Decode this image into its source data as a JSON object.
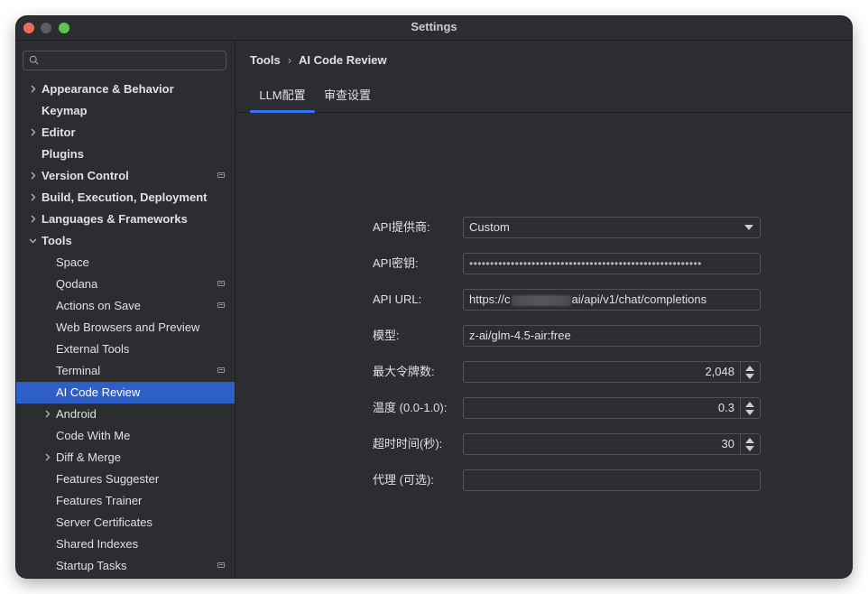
{
  "window": {
    "title": "Settings"
  },
  "search": {
    "placeholder": ""
  },
  "sidebar": {
    "items": [
      {
        "label": "Appearance & Behavior",
        "bold": true,
        "chevron": "right",
        "indent": 0,
        "badge": false,
        "selected": false
      },
      {
        "label": "Keymap",
        "bold": true,
        "chevron": "none",
        "indent": 0,
        "badge": false,
        "selected": false
      },
      {
        "label": "Editor",
        "bold": true,
        "chevron": "right",
        "indent": 0,
        "badge": false,
        "selected": false
      },
      {
        "label": "Plugins",
        "bold": true,
        "chevron": "none",
        "indent": 0,
        "badge": false,
        "selected": false
      },
      {
        "label": "Version Control",
        "bold": true,
        "chevron": "right",
        "indent": 0,
        "badge": true,
        "selected": false
      },
      {
        "label": "Build, Execution, Deployment",
        "bold": true,
        "chevron": "right",
        "indent": 0,
        "badge": false,
        "selected": false
      },
      {
        "label": "Languages & Frameworks",
        "bold": true,
        "chevron": "right",
        "indent": 0,
        "badge": false,
        "selected": false
      },
      {
        "label": "Tools",
        "bold": true,
        "chevron": "down",
        "indent": 0,
        "badge": false,
        "selected": false
      },
      {
        "label": "Space",
        "bold": false,
        "chevron": "none",
        "indent": 1,
        "badge": false,
        "selected": false
      },
      {
        "label": "Qodana",
        "bold": false,
        "chevron": "none",
        "indent": 1,
        "badge": true,
        "selected": false
      },
      {
        "label": "Actions on Save",
        "bold": false,
        "chevron": "none",
        "indent": 1,
        "badge": true,
        "selected": false
      },
      {
        "label": "Web Browsers and Preview",
        "bold": false,
        "chevron": "none",
        "indent": 1,
        "badge": false,
        "selected": false
      },
      {
        "label": "External Tools",
        "bold": false,
        "chevron": "none",
        "indent": 1,
        "badge": false,
        "selected": false
      },
      {
        "label": "Terminal",
        "bold": false,
        "chevron": "none",
        "indent": 1,
        "badge": true,
        "selected": false
      },
      {
        "label": "AI Code Review",
        "bold": false,
        "chevron": "none",
        "indent": 1,
        "badge": false,
        "selected": true
      },
      {
        "label": "Android",
        "bold": false,
        "chevron": "right",
        "indent": 1,
        "badge": false,
        "selected": false
      },
      {
        "label": "Code With Me",
        "bold": false,
        "chevron": "none",
        "indent": 1,
        "badge": false,
        "selected": false
      },
      {
        "label": "Diff & Merge",
        "bold": false,
        "chevron": "right",
        "indent": 1,
        "badge": false,
        "selected": false
      },
      {
        "label": "Features Suggester",
        "bold": false,
        "chevron": "none",
        "indent": 1,
        "badge": false,
        "selected": false
      },
      {
        "label": "Features Trainer",
        "bold": false,
        "chevron": "none",
        "indent": 1,
        "badge": false,
        "selected": false
      },
      {
        "label": "Server Certificates",
        "bold": false,
        "chevron": "none",
        "indent": 1,
        "badge": false,
        "selected": false
      },
      {
        "label": "Shared Indexes",
        "bold": false,
        "chevron": "none",
        "indent": 1,
        "badge": false,
        "selected": false
      },
      {
        "label": "Startup Tasks",
        "bold": false,
        "chevron": "none",
        "indent": 1,
        "badge": true,
        "selected": false
      }
    ]
  },
  "breadcrumb": {
    "parent": "Tools",
    "separator": "›",
    "current": "AI Code Review"
  },
  "tabs": [
    {
      "label": "LLM配置",
      "active": true
    },
    {
      "label": "审查设置",
      "active": false
    }
  ],
  "form": {
    "provider_label": "API提供商:",
    "provider_value": "Custom",
    "key_label": "API密钥:",
    "key_value": "••••••••••••••••••••••••••••••••••••••••••••••••••••••••",
    "url_label": "API URL:",
    "url_prefix": "https://c",
    "url_suffix": "ai/api/v1/chat/completions",
    "model_label": "模型:",
    "model_value": "z-ai/glm-4.5-air:free",
    "max_tokens_label": "最大令牌数:",
    "max_tokens_value": "2,048",
    "temperature_label": "温度 (0.0-1.0):",
    "temperature_value": "0.3",
    "timeout_label": "超时时间(秒):",
    "timeout_value": "30",
    "proxy_label": "代理 (可选):",
    "proxy_value": ""
  },
  "colors": {
    "accent": "#3574f0",
    "selection": "#2e5ec7",
    "background": "#2b2d30",
    "text": "#dfe1e5"
  }
}
